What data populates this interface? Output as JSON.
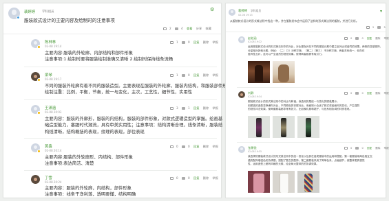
{
  "left": {
    "post": {
      "author": "裴婷婷",
      "tag": "学科组员",
      "text": "服装款式设计的主要内容及绘制时的注意事项",
      "actions": {
        "comment_count": "2",
        "likes": "4",
        "more": "查看",
        "share": "分享",
        "fav": "收藏"
      }
    },
    "comments": [
      {
        "name": "陈林林",
        "time": "02-08 19:14",
        "lines": [
          "主要内容:服装的外轮廓、内部结构和部件形象",
          "注意事项:1.绘制时要将服装绘制准确又清晰 2.绘制时保持线条流畅"
        ],
        "actions": {
          "reply_count": "1",
          "likes": "0",
          "reply": "回复",
          "report": "删除",
          "fav": "举报"
        }
      },
      {
        "name": "梁琴",
        "time": "02-08 19:17",
        "lines": [
          "不同的服装外轮廓有着不同的服装造型。主要表现在服装的外轮廓，服装内结构，和服装部件形象！",
          "绘制注重：比例，平衡，节奏，统一与变化，主次，工艺性，细节性，实用性"
        ],
        "actions": {
          "reply_count": "1",
          "likes": "0",
          "reply": "回复",
          "report": "删除",
          "fav": "举报"
        }
      },
      {
        "name": "王潇涵",
        "time": "02-08 20:03",
        "lines": [
          "主要内容：服装的外廓形，服装的内结构，服装的部件形象，对款式逻辑造型的掌握。绘画基",
          "础造型能力，塞踞时代潮流，具有审美实用性；注意事项：结构清晰合理，线条清晰，服装结",
          "构线清晰，结构概括的表现，纹理的表现，部位表现"
        ],
        "actions": {
          "reply_count": "3",
          "likes": "1",
          "reply": "回复",
          "report": "删除",
          "fav": "举报"
        }
      },
      {
        "name": "黄鑫",
        "time": "02-08 20:14",
        "lines": [
          "主要内容:服装的外轮廓形、内结构、部件形象",
          "注意事项:表达简洁、清楚"
        ],
        "actions": {
          "reply_count": "0",
          "likes": "0",
          "reply": "回复",
          "report": "删除",
          "fav": "举报"
        }
      },
      {
        "name": "丁雪",
        "time": "02-08 20:24",
        "lines": [
          "主要内容：服装的外轮廓，内结构，部件形象",
          "注意事项：线条干净利落，透明要懂，结构明确"
        ],
        "actions": {
          "reply_count": "0",
          "likes": "0",
          "reply": "回复",
          "report": "删除",
          "fav": "举报"
        }
      }
    ]
  },
  "right": {
    "post": {
      "author": "裴婷婷",
      "tag": "学科组员",
      "time": "02-08 19:13",
      "text": "从服装款式设计的形式美法则中找出一种，并在服装发布会中运用了这样的形式美法则的服装，并进行分析。",
      "actions": {
        "comment_count": "2",
        "likes": "5"
      }
    },
    "comments": [
      {
        "name": "赵若涵",
        "time": "02-08 19:22",
        "lines": [
          "运用服装款式设计的形式美法则中的对比，对比是指对在不同的服装元素中建立起对比或者同的效果。两侧的变型服饰，",
          "分量相对其他元素，例如：（二）（2）对称平衡，（第二）（第三） 不对称平衡，两者关系统一，但存在",
          "差异性互补，这可以产生强烈的视觉效果。使得两者都具有吸引力。"
        ],
        "actions": {
          "reply_count": "0",
          "likes": "0",
          "reply": "回复",
          "report": "删除",
          "fav": "举报"
        }
      },
      {
        "name": "刘静",
        "time": "02-08 19:34",
        "lines": [
          "服装款式设计的形式美法则中的对比与和谐。我选用的是统一与变化的服装展示。",
          "用服装的造型变换横向对比，不同颜色的衣服对比，而差别小合适了款式或者面料的变化，产生强烈",
          "的视觉冲击效果。使两套服装都非常有张力，比如晚礼服和裙子，与色系相协调的材质表现。"
        ],
        "actions": {
          "reply_count": "0",
          "likes": "0",
          "reply": "回复",
          "report": "删除",
          "fav": "举报"
        }
      },
      {
        "name": "张景锐",
        "time": "02-08 19:55",
        "lines": [
          "我选择的服装款式设计的形式美法则中的统一变化以及其在各类服装中的运用和搭配。第一套服装用两色相互交",
          "错的配饰增强色彩协调感，搭配了复古的配饰。第二套服装采用了简单色系，点缀细节，使整体更具视觉",
          "性，运用造型上都有风格的元素，给全局大整体的的协调效果。"
        ],
        "actions": {
          "reply_count": "0",
          "likes": "0",
          "reply": "回复",
          "report": "删除",
          "fav": "举报"
        }
      }
    ]
  }
}
